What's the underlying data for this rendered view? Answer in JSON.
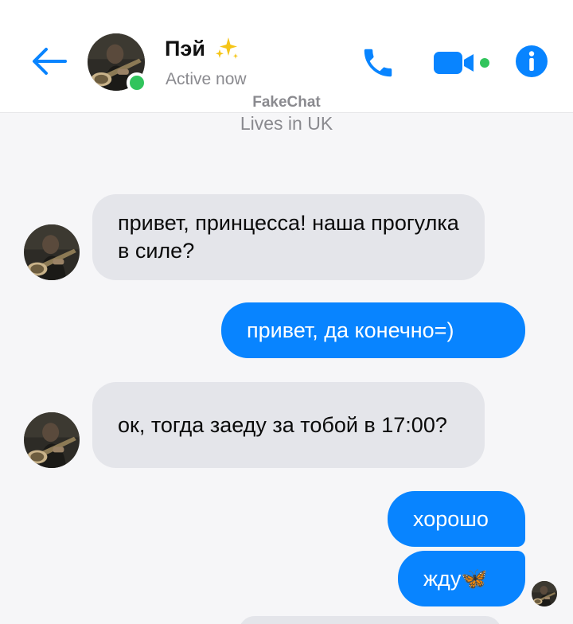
{
  "header": {
    "contact_name": "Пэй",
    "status": "Active now"
  },
  "watermark": {
    "brand": "FakeChat",
    "subtitle": "Lives in UK"
  },
  "messages": [
    {
      "direction": "incoming",
      "text": " привет, принцесса! наша прогулка в силе?"
    },
    {
      "direction": "outgoing",
      "text": "привет, да конечно=)"
    },
    {
      "direction": "incoming",
      "text": "ок, тогда заеду за тобой в 17:00?"
    },
    {
      "direction": "outgoing",
      "text": "хорошо"
    },
    {
      "direction": "outgoing",
      "text": "жду🦋"
    }
  ],
  "icons": {
    "back": "arrow-left-icon",
    "call": "phone-icon",
    "video": "video-camera-icon",
    "info": "info-icon",
    "sparkle": "sparkles-icon"
  },
  "colors": {
    "accent": "#0884ff",
    "incoming_bubble": "#e4e5ea",
    "online": "#31c45c"
  }
}
